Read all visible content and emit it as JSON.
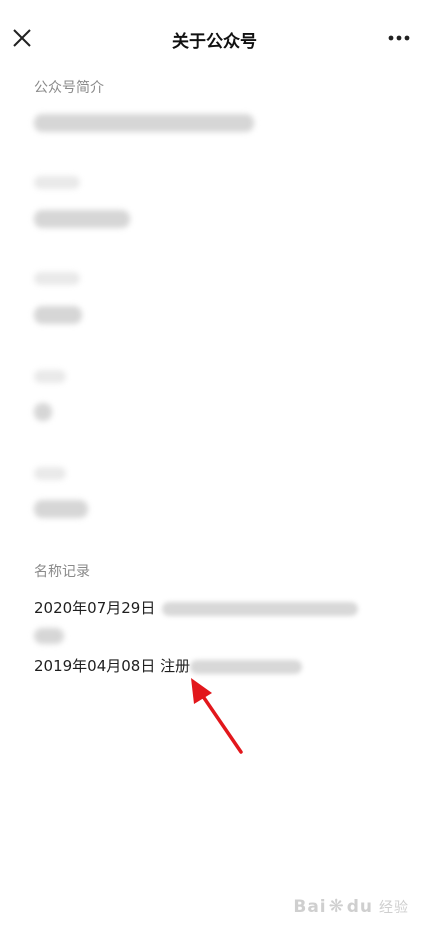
{
  "header": {
    "title": "关于公众号",
    "close_icon": "close-icon",
    "more_icon": "more-icon"
  },
  "sections": {
    "intro_label": "公众号简介",
    "name_records_label": "名称记录"
  },
  "name_records": [
    {
      "date": "2020年07月29日"
    },
    {
      "date": "2019年04月08日",
      "action": "注册"
    }
  ],
  "watermark": {
    "brand": "Bai",
    "brand2": "du",
    "sub": "经验"
  },
  "colors": {
    "annotation_arrow": "#e2171c",
    "label_gray": "#8a8a8a"
  }
}
